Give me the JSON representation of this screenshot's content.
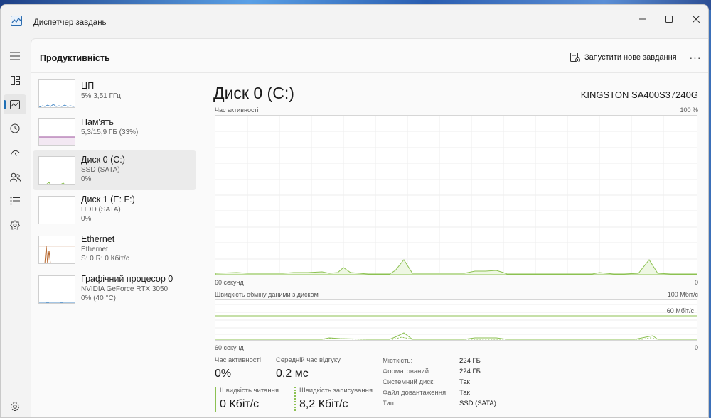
{
  "window": {
    "title": "Диспетчер завдань"
  },
  "header": {
    "page_title": "Продуктивність",
    "run_task_label": "Запустити нове завдання",
    "more_label": "···"
  },
  "resources": [
    {
      "name": "ЦП",
      "sub1": "5%  3,51 ГГц",
      "sub2": "",
      "active": false
    },
    {
      "name": "Пам'ять",
      "sub1": "5,3/15,9 ГБ (33%)",
      "sub2": "",
      "active": false
    },
    {
      "name": "Диск 0 (C:)",
      "sub1": "SSD (SATA)",
      "sub2": "0%",
      "active": true
    },
    {
      "name": "Диск 1 (E: F:)",
      "sub1": "HDD (SATA)",
      "sub2": "0%",
      "active": false
    },
    {
      "name": "Ethernet",
      "sub1": "Ethernet",
      "sub2": "S: 0 R: 0 Кбіт/с",
      "active": false
    },
    {
      "name": "Графічний процесор 0",
      "sub1": "NVIDIA GeForce RTX 3050",
      "sub2": "0%  (40 °C)",
      "active": false
    }
  ],
  "main": {
    "title": "Диск 0 (C:)",
    "model": "KINGSTON SA400S37240G",
    "graph1": {
      "label": "Час активності",
      "max": "100 %",
      "time": "60 секунд",
      "min": "0"
    },
    "graph2": {
      "label": "Швидкість обміну даними з диском",
      "max": "100 Мбіт/с",
      "ref": "60 Мбіт/с",
      "time": "60 секунд",
      "min": "0"
    }
  },
  "stats": {
    "active_time_label": "Час активності",
    "active_time_value": "0%",
    "response_label": "Середній час відгуку",
    "response_value": "0,2 мс",
    "read_label": "Швидкість читання",
    "read_value": "0 Кбіт/с",
    "write_label": "Швидкість записування",
    "write_value": "8,2 Кбіт/с"
  },
  "properties": [
    {
      "label": "Місткість:",
      "value": "224 ГБ"
    },
    {
      "label": "Форматований:",
      "value": "224 ГБ"
    },
    {
      "label": "Системний диск:",
      "value": "Так"
    },
    {
      "label": "Файл довантаження:",
      "value": "Так"
    },
    {
      "label": "Тип:",
      "value": "SSD (SATA)"
    }
  ],
  "colors": {
    "accent": "#1f6fb5",
    "disk_line": "#8cc152",
    "cpu_line": "#4a8bc7",
    "memory_line": "#9b4f9b",
    "ethernet_line": "#b5652b"
  },
  "icons": {
    "rail": [
      "hamburger-icon",
      "processes-icon",
      "performance-icon",
      "app-history-icon",
      "startup-icon",
      "users-icon",
      "details-icon",
      "services-icon",
      "settings-icon"
    ]
  }
}
